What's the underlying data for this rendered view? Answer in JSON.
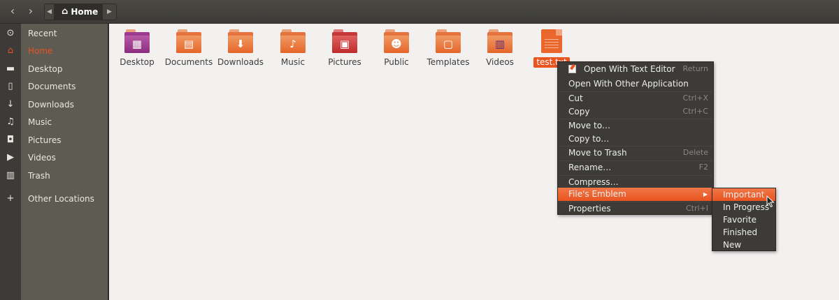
{
  "header": {
    "back_icon": "chevron-left-icon",
    "forward_icon": "chevron-right-icon",
    "path_current": "Home"
  },
  "sidebar": {
    "items": [
      {
        "label": "Recent",
        "icon": "clock-icon",
        "glyph": "⊙",
        "active": false
      },
      {
        "label": "Home",
        "icon": "home-icon",
        "glyph": "⌂",
        "active": true
      },
      {
        "label": "Desktop",
        "icon": "folder-icon",
        "glyph": "▬",
        "active": false
      },
      {
        "label": "Documents",
        "icon": "document-icon",
        "glyph": "▯",
        "active": false
      },
      {
        "label": "Downloads",
        "icon": "download-icon",
        "glyph": "↓",
        "active": false
      },
      {
        "label": "Music",
        "icon": "music-icon",
        "glyph": "♫",
        "active": false
      },
      {
        "label": "Pictures",
        "icon": "camera-icon",
        "glyph": "◘",
        "active": false
      },
      {
        "label": "Videos",
        "icon": "video-icon",
        "glyph": "▶",
        "active": false
      },
      {
        "label": "Trash",
        "icon": "trash-icon",
        "glyph": "▥",
        "active": false
      },
      {
        "label": "Other Locations",
        "icon": "plus-icon",
        "glyph": "+",
        "active": false
      }
    ],
    "accent_color": "#e95420"
  },
  "files": [
    {
      "label": "Desktop",
      "glyph": "▦"
    },
    {
      "label": "Documents",
      "glyph": "▤"
    },
    {
      "label": "Downloads",
      "glyph": "⬇"
    },
    {
      "label": "Music",
      "glyph": "♪"
    },
    {
      "label": "Pictures",
      "glyph": "▣"
    },
    {
      "label": "Public",
      "glyph": "☻"
    },
    {
      "label": "Templates",
      "glyph": "▢"
    },
    {
      "label": "Videos",
      "glyph": "▥"
    }
  ],
  "selected_file": {
    "label": "test.txt"
  },
  "context_menu": {
    "items": [
      {
        "label": "Open With Text Editor",
        "accel": "Return"
      },
      {
        "label": "Open With Other Application",
        "accel": ""
      },
      {
        "label": "Cut",
        "accel": "Ctrl+X"
      },
      {
        "label": "Copy",
        "accel": "Ctrl+C"
      },
      {
        "label": "Move to…",
        "accel": ""
      },
      {
        "label": "Copy to…",
        "accel": ""
      },
      {
        "label": "Move to Trash",
        "accel": "Delete"
      },
      {
        "label": "Rename…",
        "accel": "F2"
      },
      {
        "label": "Compress…",
        "accel": ""
      },
      {
        "label": "File's Emblem",
        "accel": ""
      },
      {
        "label": "Properties",
        "accel": "Ctrl+I"
      }
    ]
  },
  "emblem_submenu": {
    "items": [
      "Important",
      "In Progress",
      "Favorite",
      "Finished",
      "New"
    ],
    "highlighted": "Important"
  }
}
